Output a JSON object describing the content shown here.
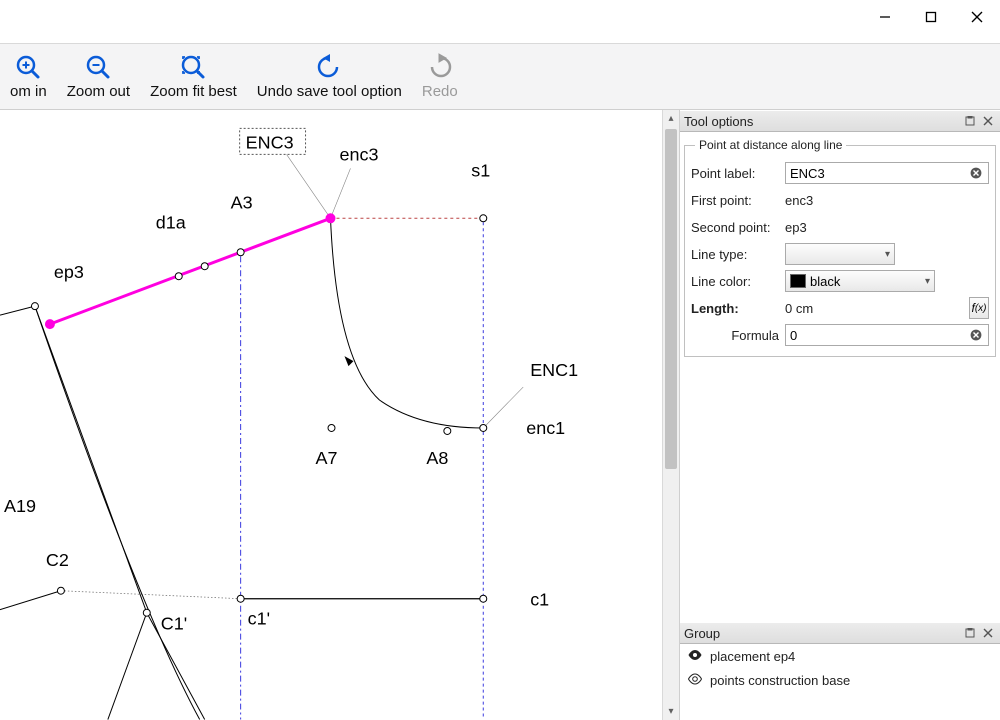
{
  "window_controls": {
    "min": "minimize",
    "max": "maximize",
    "close": "close"
  },
  "toolbar": {
    "zoom_in": "om in",
    "zoom_out": "Zoom out",
    "zoom_fit": "Zoom fit best",
    "undo": "Undo save tool option",
    "redo": "Redo"
  },
  "canvas": {
    "labels": {
      "ENC3": "ENC3",
      "enc3": "enc3",
      "s1": "s1",
      "A3": "A3",
      "d1a": "d1a",
      "ep3": "ep3",
      "A19": "A19",
      "C2": "C2",
      "C1p": "C1'",
      "c1p": "c1'",
      "A7": "A7",
      "A8": "A8",
      "ENC1": "ENC1",
      "enc1": "enc1",
      "c1": "c1"
    }
  },
  "tool_options": {
    "dock_title": "Tool options",
    "legend": "Point at distance along line",
    "point_label_label": "Point label:",
    "point_label_value": "ENC3",
    "first_point_label": "First point:",
    "first_point_value": "enc3",
    "second_point_label": "Second point:",
    "second_point_value": "ep3",
    "line_type_label": "Line type:",
    "line_color_label": "Line color:",
    "line_color_value": "black",
    "length_label": "Length:",
    "length_value": "0 cm",
    "formula_label": "Formula",
    "formula_value": "0"
  },
  "group_panel": {
    "dock_title": "Group",
    "items": [
      {
        "icon": "eye-filled",
        "label": "placement ep4"
      },
      {
        "icon": "eye-outline",
        "label": "points construction base"
      }
    ]
  }
}
